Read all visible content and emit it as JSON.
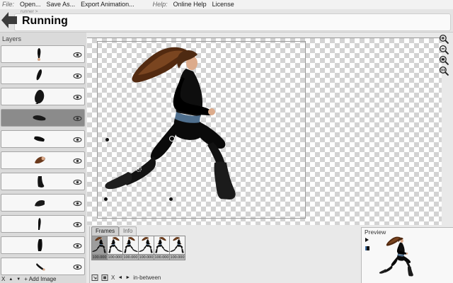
{
  "menu": {
    "file_label": "File:",
    "open": "Open...",
    "save_as": "Save As...",
    "export_animation": "Export Animation...",
    "help_label": "Help:",
    "online_help": "Online Help",
    "license": "License"
  },
  "header": {
    "breadcrumb": "runner >",
    "title": "Running"
  },
  "layers": {
    "title": "Layers",
    "selected_index": 3,
    "items": [
      {
        "part": "forearm-hand"
      },
      {
        "part": "upper-arm"
      },
      {
        "part": "torso"
      },
      {
        "part": "thigh"
      },
      {
        "part": "calf"
      },
      {
        "part": "head-hair"
      },
      {
        "part": "front-boot"
      },
      {
        "part": "back-boot"
      },
      {
        "part": "shin"
      },
      {
        "part": "lower-leg"
      },
      {
        "part": "arm-small"
      }
    ],
    "footer": {
      "delete": "X",
      "move_up": "▲",
      "move_down": "▼",
      "add_image": "+ Add Image"
    }
  },
  "zoom_tools": [
    "zoom-in",
    "zoom-out",
    "zoom-fit",
    "zoom-actual-size"
  ],
  "frames_panel": {
    "tabs": {
      "frames": "Frames",
      "info": "Info"
    },
    "active_tab": "Frames",
    "frames": [
      {
        "duration": "100.000",
        "selected": true
      },
      {
        "duration": "100.000",
        "selected": false
      },
      {
        "duration": "100.000",
        "selected": false
      },
      {
        "duration": "100.000",
        "selected": false
      },
      {
        "duration": "100.000",
        "selected": false
      },
      {
        "duration": "100.000",
        "selected": false
      }
    ],
    "controls": {
      "delete": "X",
      "prev": "◄",
      "next": "►",
      "inbetween": "in-between"
    }
  },
  "preview": {
    "title": "Preview"
  },
  "colors": {
    "selected_layer_bg": "#8b8b8b",
    "checker_gray": "#d3d3d3",
    "hair_brown": "#60331a",
    "skin": "#dcab8b",
    "belt_blue": "#4f6f8e",
    "suit_black": "#0e0e0e"
  }
}
